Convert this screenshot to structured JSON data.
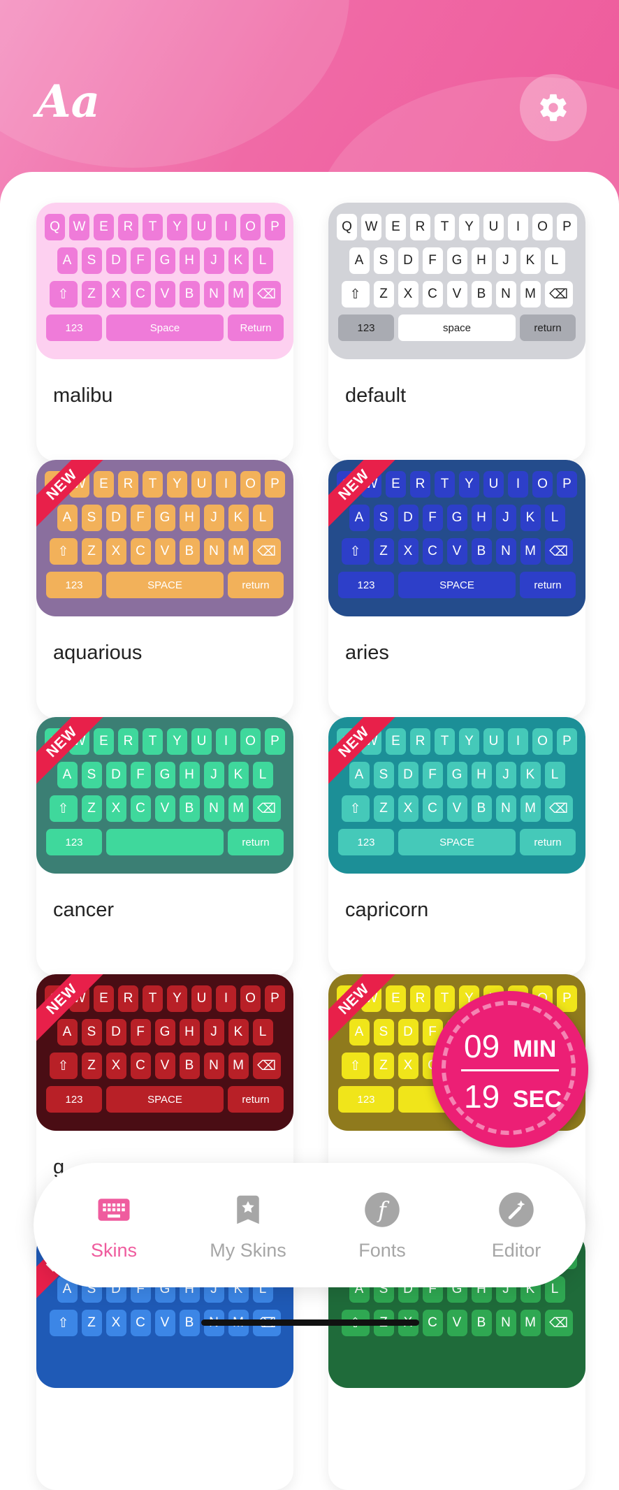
{
  "header": {
    "logo": "Aa",
    "settings_icon": "gear-icon"
  },
  "keyboard_rows": [
    [
      "Q",
      "W",
      "E",
      "R",
      "T",
      "Y",
      "U",
      "I",
      "O",
      "P"
    ],
    [
      "A",
      "S",
      "D",
      "F",
      "G",
      "H",
      "J",
      "K",
      "L"
    ],
    [
      "Z",
      "X",
      "C",
      "V",
      "B",
      "N",
      "M"
    ]
  ],
  "skins": [
    {
      "name": "malibu",
      "is_new": false,
      "bottom_row": [
        "123",
        "Space",
        "Return"
      ],
      "colors": {
        "bg": "#fdd0f0",
        "key": "#ef7bd9",
        "key_text": "#ffffff"
      }
    },
    {
      "name": "default",
      "is_new": false,
      "bottom_row": [
        "123",
        "space",
        "return"
      ],
      "colors": {
        "bg": "#d2d3d8",
        "key": "#ffffff",
        "key_text": "#222222"
      }
    },
    {
      "name": "aquarious",
      "is_new": true,
      "bottom_row": [
        "123",
        "SPACE",
        "return"
      ],
      "colors": {
        "bg": "#8a6f9e",
        "key": "#f2b15a",
        "key_text": "#ffffff"
      }
    },
    {
      "name": "aries",
      "is_new": true,
      "bottom_row": [
        "123",
        "SPACE",
        "return"
      ],
      "colors": {
        "bg": "#244c8c",
        "key": "#2d3fc9",
        "key_text": "#ffffff"
      }
    },
    {
      "name": "cancer",
      "is_new": true,
      "bottom_row": [
        "123",
        "",
        "return"
      ],
      "colors": {
        "bg": "#3b7f74",
        "key": "#3fd89c",
        "key_text": "#ffffff"
      }
    },
    {
      "name": "capricorn",
      "is_new": true,
      "bottom_row": [
        "123",
        "SPACE",
        "return"
      ],
      "colors": {
        "bg": "#1c8f97",
        "key": "#45c9b9",
        "key_text": "#ffffff"
      }
    },
    {
      "name": "g",
      "is_new": true,
      "bottom_row": [
        "123",
        "SPACE",
        "return"
      ],
      "colors": {
        "bg": "#4a0d14",
        "key": "#b82027",
        "key_text": "#ffffff"
      }
    },
    {
      "name": "",
      "is_new": true,
      "bottom_row": [
        "123",
        "",
        ""
      ],
      "colors": {
        "bg": "#8f7a1d",
        "key": "#f0e51a",
        "key_text": "#ffffff"
      }
    },
    {
      "name": "",
      "is_new": true,
      "bottom_row": [],
      "colors": {
        "bg": "#1f5ab6",
        "key": "#3c86e6",
        "key_text": "#ffffff"
      }
    },
    {
      "name": "",
      "is_new": false,
      "bottom_row": [],
      "colors": {
        "bg": "#1f6b3a",
        "key": "#2fa852",
        "key_text": "#ffffff"
      }
    }
  ],
  "badge_text": "NEW",
  "timer": {
    "minutes": "09",
    "minutes_unit": "MIN",
    "seconds": "19",
    "seconds_unit": "SEC"
  },
  "nav": [
    {
      "label": "Skins",
      "icon": "keyboard-icon",
      "active": true
    },
    {
      "label": "My Skins",
      "icon": "bookmark-icon",
      "active": false
    },
    {
      "label": "Fonts",
      "icon": "font-icon",
      "active": false
    },
    {
      "label": "Editor",
      "icon": "magic-wand-icon",
      "active": false
    }
  ],
  "colors": {
    "accent": "#ef5c9e",
    "nav_inactive": "#a6a6a6",
    "timer_bg": "#ec1f75"
  }
}
